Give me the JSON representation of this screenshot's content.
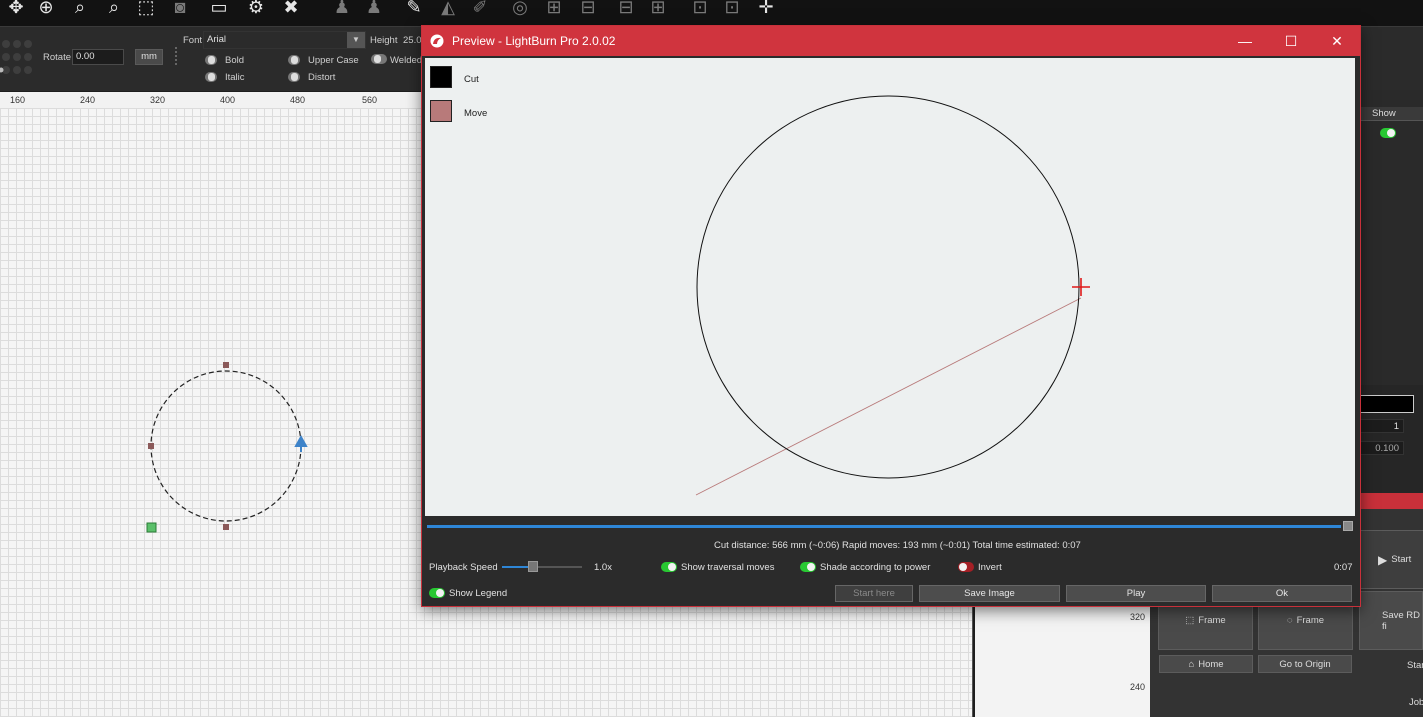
{
  "toolbar": {
    "icons": [
      "move-icon",
      "zoom-page-icon",
      "zoom-in-icon",
      "zoom-out-icon",
      "zoom-selection-icon",
      "camera-icon",
      "monitor-icon",
      "gear-icon",
      "tools-icon",
      "users-icon",
      "user-icon",
      "edit-icon",
      "mirror-icon",
      "pen-icon",
      "target-icon",
      "align-icon",
      "distribute-icon",
      "align-middle-icon",
      "group-icon",
      "spacing-icon",
      "anchor-icon"
    ]
  },
  "optbar": {
    "rotate_label": "Rotate",
    "rotate_value": "0.00",
    "unit_button": "mm",
    "font_label": "Font",
    "font_value": "Arial",
    "height_label": "Height",
    "height_value": "25.0",
    "bold_label": "Bold",
    "italic_label": "Italic",
    "upper_case_label": "Upper Case",
    "distort_label": "Distort",
    "welded_label": "Welded"
  },
  "ruler": {
    "ticks": [
      "160",
      "240",
      "320",
      "400",
      "480",
      "560"
    ]
  },
  "right_panel": {
    "show_label": "Show",
    "value_count": "1",
    "value_small": "0.100",
    "start_button": "Start",
    "save_rd_button": "Save RD fi",
    "frame_button_1": "Frame",
    "frame_button_2": "Frame",
    "home_button": "Home",
    "go_origin_button": "Go to Origin",
    "start_from_label": "Star",
    "job_label": "Job",
    "ruler_320": "320",
    "ruler_240": "240"
  },
  "preview": {
    "title": "Preview - LightBurn Pro 2.0.02",
    "legend": [
      {
        "label": "Cut",
        "color": "#000000"
      },
      {
        "label": "Move",
        "color": "#b87a7a"
      }
    ],
    "stats": "Cut distance: 566 mm (~0:06)   Rapid moves: 193 mm (~0:01)   Total time estimated: 0:07",
    "playback_label": "Playback Speed",
    "playback_value": "1.0x",
    "show_traversal_label": "Show traversal moves",
    "shade_label": "Shade according to power",
    "invert_label": "Invert",
    "time_label": "0:07",
    "show_legend_label": "Show Legend",
    "start_here_button": "Start here",
    "save_image_button": "Save Image",
    "play_button": "Play",
    "ok_button": "Ok",
    "progress": 1.0
  }
}
